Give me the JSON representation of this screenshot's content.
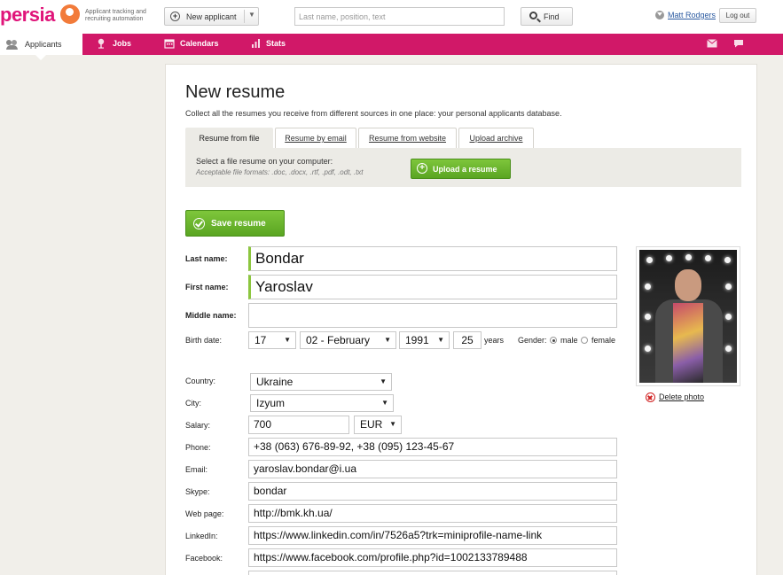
{
  "header": {
    "logo_text": "persia",
    "tagline": "Applicant tracking and recruiting automation",
    "new_applicant_label": "New applicant",
    "search_placeholder": "Last name, position, text",
    "find_label": "Find",
    "user_name": "Matt Rodgers",
    "logout_label": "Log out"
  },
  "nav": {
    "items": [
      {
        "label": "Applicants",
        "icon": "users-icon",
        "active": true
      },
      {
        "label": "Jobs",
        "icon": "jobs-icon"
      },
      {
        "label": "Calendars",
        "icon": "calendar-icon"
      },
      {
        "label": "Stats",
        "icon": "stats-icon"
      }
    ],
    "right_icons": [
      "mail-icon",
      "chat-icon"
    ]
  },
  "page": {
    "title": "New resume",
    "subtitle": "Collect all the resumes you receive from different sources in one place: your personal applicants database.",
    "tabs": [
      {
        "label": "Resume from file",
        "active": true
      },
      {
        "label": "Resume by email"
      },
      {
        "label": "Resume from website"
      },
      {
        "label": "Upload archive"
      }
    ],
    "upload": {
      "line1": "Select a file resume on your computer:",
      "line2": "Acceptable file formats: .doc, .docx, .rtf, .pdf, .odt, .txt",
      "button": "Upload a resume"
    },
    "save_button": "Save resume"
  },
  "form": {
    "last_name_label": "Last name:",
    "last_name": "Bondar",
    "first_name_label": "First name:",
    "first_name": "Yaroslav",
    "middle_name_label": "Middle name:",
    "middle_name": "",
    "birth_label": "Birth date:",
    "birth_day": "17",
    "birth_month": "02 - February",
    "birth_year": "1991",
    "age": "25",
    "years_label": "years",
    "gender_label": "Gender:",
    "gender_male": "male",
    "gender_female": "female",
    "gender_selected": "male",
    "country_label": "Country:",
    "country": "Ukraine",
    "city_label": "City:",
    "city": "Izyum",
    "salary_label": "Salary:",
    "salary": "700",
    "currency": "EUR",
    "phone_label": "Phone:",
    "phone": "+38 (063) 676-89-92, +38 (095) 123-45-67",
    "email_label": "Email:",
    "email": "yaroslav.bondar@i.ua",
    "skype_label": "Skype:",
    "skype": "bondar",
    "webpage_label": "Web page:",
    "webpage": "http://bmk.kh.ua/",
    "linkedin_label": "LinkedIn:",
    "linkedin": "https://www.linkedin.com/in/7526a5?trk=miniprofile-name-link",
    "facebook_label": "Facebook:",
    "facebook": "https://www.facebook.com/profile.php?id=1002133789488"
  },
  "photo": {
    "delete_label": "Delete photo"
  },
  "colors": {
    "brand": "#d11868",
    "accent_green": "#6bb52e",
    "link": "#2b5aa0"
  }
}
